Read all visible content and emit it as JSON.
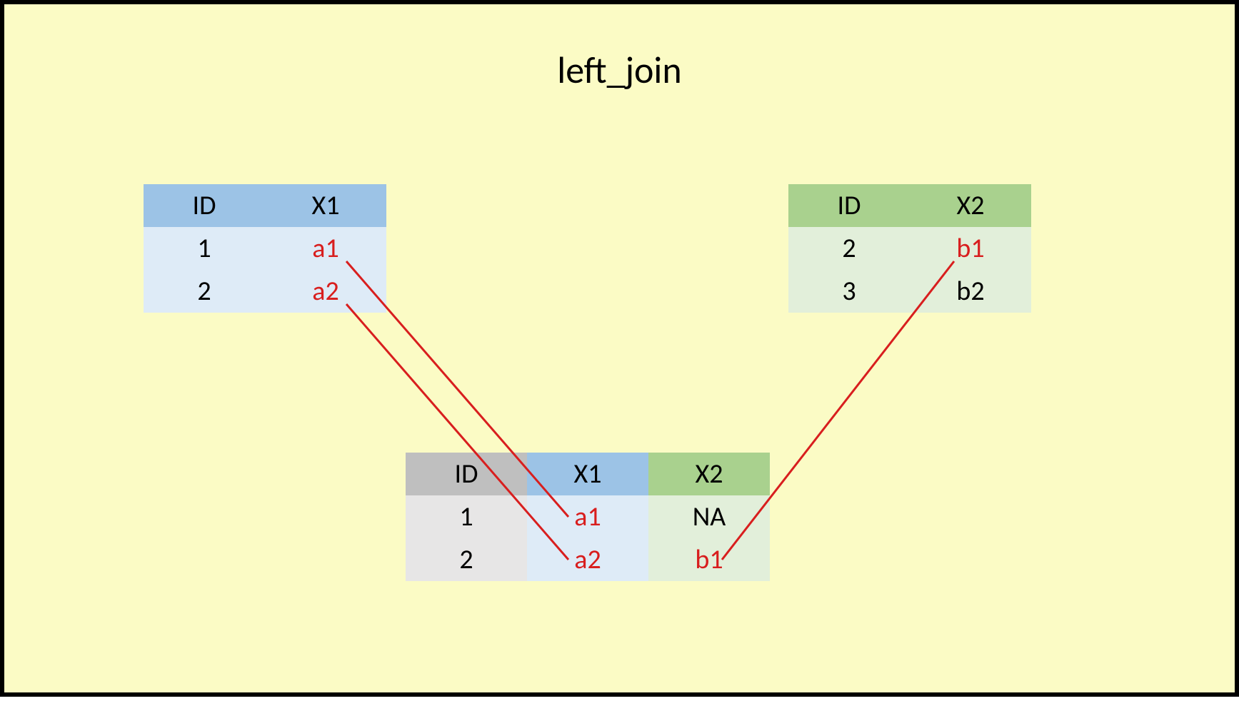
{
  "title": "left_join",
  "chart_data": {
    "type": "table",
    "description": "Illustration of a left_join operation between two tables on key ID. Red arrows map source cells to result cells.",
    "left_table": {
      "headers": [
        "ID",
        "X1"
      ],
      "rows": [
        {
          "ID": "1",
          "X1": "a1"
        },
        {
          "ID": "2",
          "X1": "a2"
        }
      ],
      "header_fill": "#9cc3e6",
      "body_fill": "#deebf7"
    },
    "right_table": {
      "headers": [
        "ID",
        "X2"
      ],
      "rows": [
        {
          "ID": "2",
          "X2": "b1"
        },
        {
          "ID": "3",
          "X2": "b2"
        }
      ],
      "header_fill": "#a9d18e",
      "body_fill": "#e2efda"
    },
    "result_table": {
      "headers": [
        "ID",
        "X1",
        "X2"
      ],
      "rows": [
        {
          "ID": "1",
          "X1": "a1",
          "X2": "NA"
        },
        {
          "ID": "2",
          "X1": "a2",
          "X2": "b1"
        }
      ],
      "col_fills": {
        "ID": {
          "header": "#bfbfbf",
          "body": "#e7e6e6"
        },
        "X1": {
          "header": "#9cc3e6",
          "body": "#deebf7"
        },
        "X2": {
          "header": "#a9d18e",
          "body": "#e2efda"
        }
      }
    },
    "highlighted_cells": [
      "a1",
      "a2",
      "b1"
    ],
    "arrows": [
      {
        "from": "left_table.X1[0] (a1)",
        "to": "result_table.X1[0] (a1)"
      },
      {
        "from": "left_table.X1[1] (a2)",
        "to": "result_table.X1[1] (a2)"
      },
      {
        "from": "right_table.X2[0] (b1)",
        "to": "result_table.X2[1] (b1)"
      }
    ]
  }
}
